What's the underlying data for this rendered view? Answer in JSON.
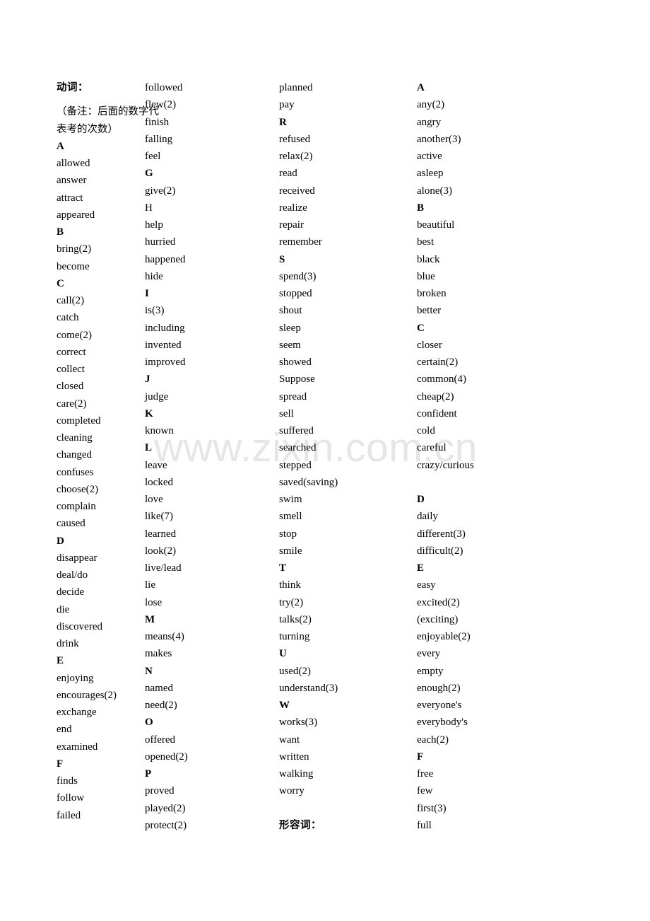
{
  "document": {
    "verbs_heading": "动词：",
    "verbs_note_line1": "（备注：后面的数字代",
    "verbs_note_line2": "表考的次数）",
    "adjectives_heading": "形容词：",
    "watermark": "www.zixin.com.cn"
  },
  "columns": [
    {
      "id": "column-1",
      "entries": [
        {
          "text": "A",
          "bold": true
        },
        {
          "text": "allowed",
          "bold": false
        },
        {
          "text": "answer",
          "bold": false
        },
        {
          "text": "attract",
          "bold": false
        },
        {
          "text": "appeared",
          "bold": false
        },
        {
          "text": "B",
          "bold": true
        },
        {
          "text": "bring(2)",
          "bold": false
        },
        {
          "text": "become",
          "bold": false
        },
        {
          "text": "C",
          "bold": true
        },
        {
          "text": "call(2)",
          "bold": false
        },
        {
          "text": "catch",
          "bold": false
        },
        {
          "text": "come(2)",
          "bold": false
        },
        {
          "text": "correct",
          "bold": false
        },
        {
          "text": "collect",
          "bold": false
        },
        {
          "text": "closed",
          "bold": false
        },
        {
          "text": "care(2)",
          "bold": false
        },
        {
          "text": "completed",
          "bold": false
        },
        {
          "text": "cleaning",
          "bold": false
        },
        {
          "text": "changed",
          "bold": false
        },
        {
          "text": "confuses",
          "bold": false
        },
        {
          "text": "choose(2)",
          "bold": false
        },
        {
          "text": "complain",
          "bold": false
        },
        {
          "text": "caused",
          "bold": false
        },
        {
          "text": "D",
          "bold": true
        },
        {
          "text": "disappear",
          "bold": false
        },
        {
          "text": "deal/do",
          "bold": false
        },
        {
          "text": "decide",
          "bold": false
        },
        {
          "text": "die",
          "bold": false
        },
        {
          "text": "discovered",
          "bold": false
        },
        {
          "text": "drink",
          "bold": false
        },
        {
          "text": "E",
          "bold": true
        },
        {
          "text": "enjoying",
          "bold": false
        },
        {
          "text": "encourages(2)",
          "bold": false
        },
        {
          "text": "exchange",
          "bold": false
        },
        {
          "text": "end",
          "bold": false
        },
        {
          "text": "examined",
          "bold": false
        },
        {
          "text": "F",
          "bold": true
        },
        {
          "text": "finds",
          "bold": false
        },
        {
          "text": "follow",
          "bold": false
        },
        {
          "text": "failed",
          "bold": false
        }
      ]
    },
    {
      "id": "column-2",
      "entries": [
        {
          "text": "followed",
          "bold": false
        },
        {
          "text": "flew(2)",
          "bold": false
        },
        {
          "text": "finish",
          "bold": false
        },
        {
          "text": "falling",
          "bold": false
        },
        {
          "text": "feel",
          "bold": false
        },
        {
          "text": "G",
          "bold": true
        },
        {
          "text": "give(2)",
          "bold": false
        },
        {
          "text": "H",
          "bold": false
        },
        {
          "text": "help",
          "bold": false
        },
        {
          "text": "hurried",
          "bold": false
        },
        {
          "text": "happened",
          "bold": false
        },
        {
          "text": "hide",
          "bold": false
        },
        {
          "text": "I",
          "bold": true
        },
        {
          "text": "is(3)",
          "bold": false
        },
        {
          "text": "including",
          "bold": false
        },
        {
          "text": "invented",
          "bold": false
        },
        {
          "text": "improved",
          "bold": false
        },
        {
          "text": "J",
          "bold": true
        },
        {
          "text": "judge",
          "bold": false
        },
        {
          "text": "K",
          "bold": true
        },
        {
          "text": "known",
          "bold": false
        },
        {
          "text": "L",
          "bold": true
        },
        {
          "text": "leave",
          "bold": false
        },
        {
          "text": "locked",
          "bold": false
        },
        {
          "text": "love",
          "bold": false
        },
        {
          "text": "like(7)",
          "bold": false
        },
        {
          "text": "learned",
          "bold": false
        },
        {
          "text": "look(2)",
          "bold": false
        },
        {
          "text": "live/lead",
          "bold": false
        },
        {
          "text": "lie",
          "bold": false
        },
        {
          "text": "lose",
          "bold": false
        },
        {
          "text": "M",
          "bold": true
        },
        {
          "text": "means(4)",
          "bold": false
        },
        {
          "text": "makes",
          "bold": false
        },
        {
          "text": "N",
          "bold": true
        },
        {
          "text": "named",
          "bold": false
        },
        {
          "text": "need(2)",
          "bold": false
        },
        {
          "text": "O",
          "bold": true
        },
        {
          "text": "offered",
          "bold": false
        },
        {
          "text": "opened(2)",
          "bold": false
        },
        {
          "text": "P",
          "bold": true
        },
        {
          "text": "proved",
          "bold": false
        },
        {
          "text": "played(2)",
          "bold": false
        },
        {
          "text": "protect(2)",
          "bold": false
        }
      ]
    },
    {
      "id": "column-3",
      "entries": [
        {
          "text": "planned",
          "bold": false
        },
        {
          "text": "pay",
          "bold": false
        },
        {
          "text": "R",
          "bold": true
        },
        {
          "text": "refused",
          "bold": false
        },
        {
          "text": "relax(2)",
          "bold": false
        },
        {
          "text": "read",
          "bold": false
        },
        {
          "text": "received",
          "bold": false
        },
        {
          "text": "realize",
          "bold": false
        },
        {
          "text": "repair",
          "bold": false
        },
        {
          "text": "remember",
          "bold": false
        },
        {
          "text": "S",
          "bold": true
        },
        {
          "text": "spend(3)",
          "bold": false
        },
        {
          "text": "stopped",
          "bold": false
        },
        {
          "text": "shout",
          "bold": false
        },
        {
          "text": "sleep",
          "bold": false
        },
        {
          "text": "seem",
          "bold": false
        },
        {
          "text": "showed",
          "bold": false
        },
        {
          "text": "Suppose",
          "bold": false
        },
        {
          "text": "spread",
          "bold": false
        },
        {
          "text": "sell",
          "bold": false
        },
        {
          "text": "suffered",
          "bold": false
        },
        {
          "text": "searched",
          "bold": false
        },
        {
          "text": "stepped",
          "bold": false
        },
        {
          "text": "saved(saving)",
          "bold": false
        },
        {
          "text": "swim",
          "bold": false
        },
        {
          "text": "smell",
          "bold": false
        },
        {
          "text": "stop",
          "bold": false
        },
        {
          "text": "smile",
          "bold": false
        },
        {
          "text": "T",
          "bold": true
        },
        {
          "text": "think",
          "bold": false
        },
        {
          "text": "try(2)",
          "bold": false
        },
        {
          "text": "talks(2)",
          "bold": false
        },
        {
          "text": "turning",
          "bold": false
        },
        {
          "text": "U",
          "bold": true
        },
        {
          "text": "used(2)",
          "bold": false
        },
        {
          "text": "understand(3)",
          "bold": false
        },
        {
          "text": "W",
          "bold": true
        },
        {
          "text": "works(3)",
          "bold": false
        },
        {
          "text": "want",
          "bold": false
        },
        {
          "text": "written",
          "bold": false
        },
        {
          "text": "walking",
          "bold": false
        },
        {
          "text": "worry",
          "bold": false
        }
      ]
    },
    {
      "id": "column-4",
      "entries": [
        {
          "text": "A",
          "bold": true
        },
        {
          "text": "any(2)",
          "bold": false
        },
        {
          "text": "angry",
          "bold": false
        },
        {
          "text": "another(3)",
          "bold": false
        },
        {
          "text": "active",
          "bold": false
        },
        {
          "text": "asleep",
          "bold": false
        },
        {
          "text": "alone(3)",
          "bold": false
        },
        {
          "text": "B",
          "bold": true
        },
        {
          "text": "beautiful",
          "bold": false
        },
        {
          "text": "best",
          "bold": false
        },
        {
          "text": "black",
          "bold": false
        },
        {
          "text": "blue",
          "bold": false
        },
        {
          "text": "broken",
          "bold": false
        },
        {
          "text": "better",
          "bold": false
        },
        {
          "text": "C",
          "bold": true
        },
        {
          "text": "closer",
          "bold": false
        },
        {
          "text": "certain(2)",
          "bold": false
        },
        {
          "text": "common(4)",
          "bold": false
        },
        {
          "text": "cheap(2)",
          "bold": false
        },
        {
          "text": "confident",
          "bold": false
        },
        {
          "text": "cold",
          "bold": false
        },
        {
          "text": "careful",
          "bold": false
        },
        {
          "text": "crazy/curious",
          "bold": false
        },
        {
          "text": "",
          "bold": false
        },
        {
          "text": "D",
          "bold": true
        },
        {
          "text": "daily",
          "bold": false
        },
        {
          "text": "different(3)",
          "bold": false
        },
        {
          "text": "difficult(2)",
          "bold": false
        },
        {
          "text": "E",
          "bold": true
        },
        {
          "text": "easy",
          "bold": false
        },
        {
          "text": "excited(2)",
          "bold": false
        },
        {
          "text": "(exciting)",
          "bold": false
        },
        {
          "text": "enjoyable(2)",
          "bold": false
        },
        {
          "text": "every",
          "bold": false
        },
        {
          "text": "empty",
          "bold": false
        },
        {
          "text": "enough(2)",
          "bold": false
        },
        {
          "text": "everyone's",
          "bold": false
        },
        {
          "text": "everybody's",
          "bold": false
        },
        {
          "text": "each(2)",
          "bold": false
        },
        {
          "text": "F",
          "bold": true
        },
        {
          "text": "free",
          "bold": false
        },
        {
          "text": "few",
          "bold": false
        },
        {
          "text": "first(3)",
          "bold": false
        },
        {
          "text": "full",
          "bold": false
        }
      ]
    }
  ]
}
